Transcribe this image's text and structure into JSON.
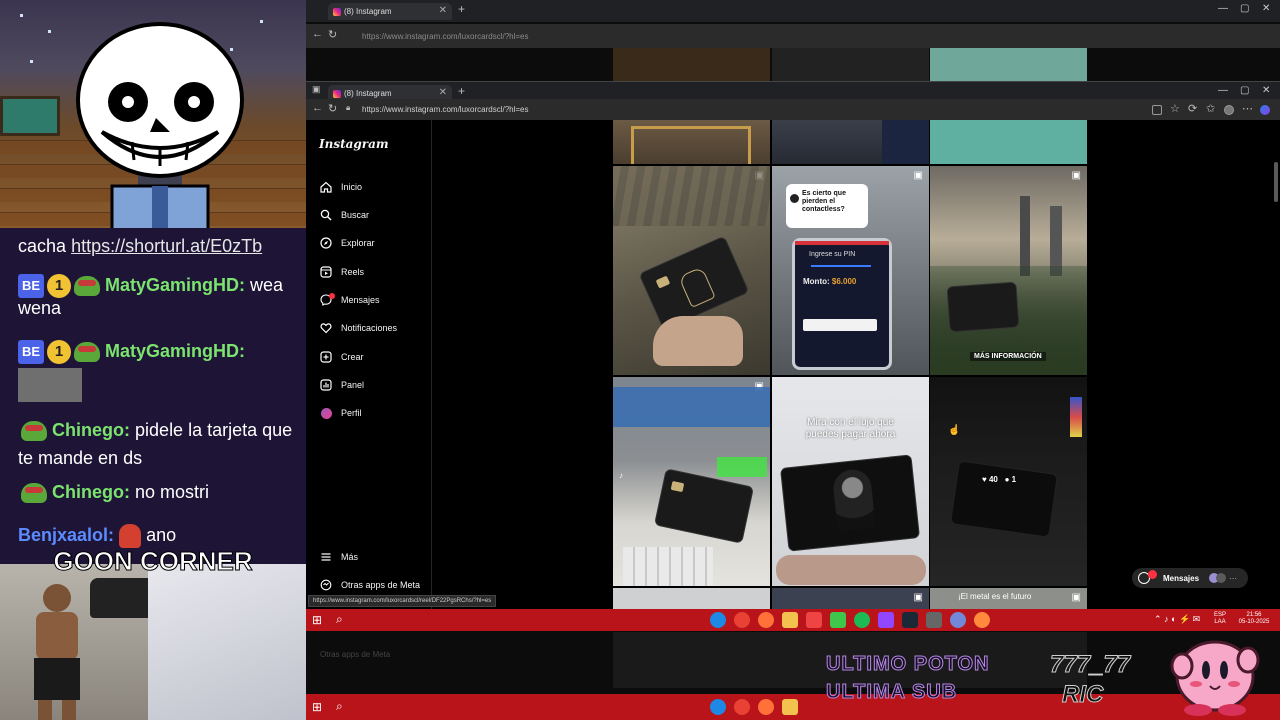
{
  "chat": {
    "line1": {
      "text": "cacha",
      "link": "https://shorturl.at/E0zTb"
    },
    "line2": {
      "badge": "BE",
      "sub": "1",
      "user": "MatyGamingHD",
      "message": "wea wena"
    },
    "line3": {
      "badge": "BE",
      "sub": "1",
      "user": "MatyGamingHD"
    },
    "line4": {
      "user": "Chinego",
      "message": "pidele la tarjeta que te mande en ds"
    },
    "line5": {
      "user": "Chinego",
      "message": "no mostri"
    },
    "line6": {
      "user": "Benjxaalol",
      "message": "ano"
    }
  },
  "overlay": {
    "goon": "GOON CORNER",
    "ultimo1": "ULTIMO POTON",
    "ultimo2": "ULTIMA SUB",
    "ric1": "777_77",
    "ric2": "RIC"
  },
  "browser": {
    "tab_title": "(8) Instagram",
    "url": "https://www.instagram.com/luxorcardscl/?hl=es",
    "hover_url": "https://www.instagram.com/luxorcardscl/reel/DF22PgsRChs/?hl=es"
  },
  "sidebar": {
    "logo": "Instagram",
    "items": [
      {
        "label": "Inicio",
        "icon": "home-icon"
      },
      {
        "label": "Buscar",
        "icon": "search-icon"
      },
      {
        "label": "Explorar",
        "icon": "compass-icon"
      },
      {
        "label": "Reels",
        "icon": "reels-icon"
      },
      {
        "label": "Mensajes",
        "icon": "messenger-icon"
      },
      {
        "label": "Notificaciones",
        "icon": "heart-icon"
      },
      {
        "label": "Crear",
        "icon": "plus-icon"
      },
      {
        "label": "Panel",
        "icon": "chart-icon"
      },
      {
        "label": "Perfil",
        "icon": "avatar-icon"
      }
    ],
    "more": "Más",
    "other_apps": "Otras apps de Meta"
  },
  "posts": {
    "p2_q1": "Es cierto que",
    "p2_q2": "pierden el",
    "p2_q3": "contactless?",
    "p2_pin": "Ingrese su PIN",
    "p2_monto": "Monto:",
    "p2_amount": "$6.000",
    "p3_cta": "MÁS INFORMACIÓN",
    "p5_caption1": "Mira con el lujo que",
    "p5_caption2": "puedes pagar ahora",
    "p6_likes": "40",
    "p6_comments": "1",
    "p6_caption": "¡El metal es el futuro"
  },
  "messages_pill": {
    "label": "Mensajes"
  },
  "taskbar": {
    "lang1": "ESP",
    "lang2": "LAA",
    "time": "21:56",
    "date": "05-10-2025"
  }
}
